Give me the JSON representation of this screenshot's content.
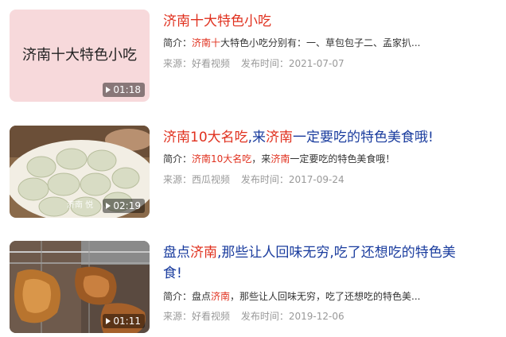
{
  "results": [
    {
      "thumb_text": "济南十大特色小吃",
      "duration": "01:18",
      "title_parts": [
        {
          "text": "济南",
          "hl": true
        },
        {
          "text": "十大特色小吃",
          "hl": true
        }
      ],
      "summary_parts": [
        {
          "text": "简介：",
          "hl": false
        },
        {
          "text": "济南十",
          "hl": true
        },
        {
          "text": "大特色小吃分别有：一、草包包子二、孟家扒...",
          "hl": false
        }
      ],
      "source": "来源：好看视频",
      "date": "发布时间：2021-07-07"
    },
    {
      "duration": "02:19",
      "watermark": "济南 悦",
      "title_parts": [
        {
          "text": "济南10大名吃",
          "hl": true
        },
        {
          "text": ",来",
          "hl": false
        },
        {
          "text": "济南",
          "hl": true
        },
        {
          "text": "一定要吃的特色美食哦!",
          "hl": false
        }
      ],
      "summary_parts": [
        {
          "text": "简介：",
          "hl": false
        },
        {
          "text": "济南10大名吃",
          "hl": true
        },
        {
          "text": "，来",
          "hl": false
        },
        {
          "text": "济南",
          "hl": true
        },
        {
          "text": "一定要吃的特色美食哦！",
          "hl": false
        }
      ],
      "source": "来源：西瓜视频",
      "date": "发布时间：2017-09-24"
    },
    {
      "duration": "01:11",
      "title_parts": [
        {
          "text": "盘点",
          "hl": false
        },
        {
          "text": "济南",
          "hl": true
        },
        {
          "text": ",那些让人回味无穷,吃了还想吃的特色美食!",
          "hl": false
        }
      ],
      "summary_parts": [
        {
          "text": "简介：盘点",
          "hl": false
        },
        {
          "text": "济南",
          "hl": true
        },
        {
          "text": "，那些让人回味无穷，吃了还想吃的特色美...",
          "hl": false
        }
      ],
      "source": "来源：好看视频",
      "date": "发布时间：2019-12-06"
    }
  ]
}
